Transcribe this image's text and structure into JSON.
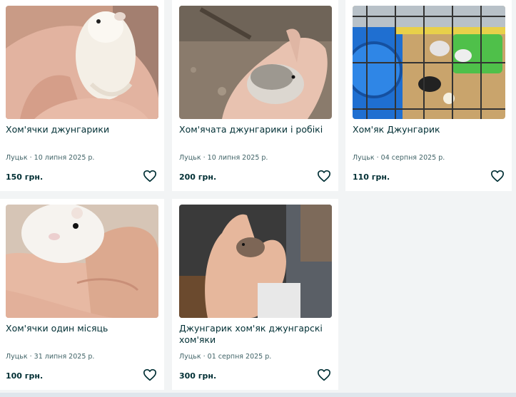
{
  "listings": [
    {
      "title": "Хом'ячки джунгарики",
      "location": "Луцьк",
      "date": "10 липня 2025 р.",
      "price": "150 грн."
    },
    {
      "title": "Хом'ячата джунгарики і робікі",
      "location": "Луцьк",
      "date": "10 липня 2025 р.",
      "price": "200 грн."
    },
    {
      "title": "Хом'як Джунгарик",
      "location": "Луцьк",
      "date": "04 серпня 2025 р.",
      "price": "110 грн."
    },
    {
      "title": "Хом'ячки один місяць",
      "location": "Луцьк",
      "date": "31 липня 2025 р.",
      "price": "100 грн."
    },
    {
      "title": "Джунгарик хом'як джунгарскі хом'яки",
      "location": "Луцьк",
      "date": "01 серпня 2025 р.",
      "price": "300 грн."
    }
  ],
  "meta_separator": "·",
  "colors": {
    "text": "#002f34",
    "muted": "#406367",
    "card": "#ffffff",
    "background": "#f2f4f5"
  }
}
